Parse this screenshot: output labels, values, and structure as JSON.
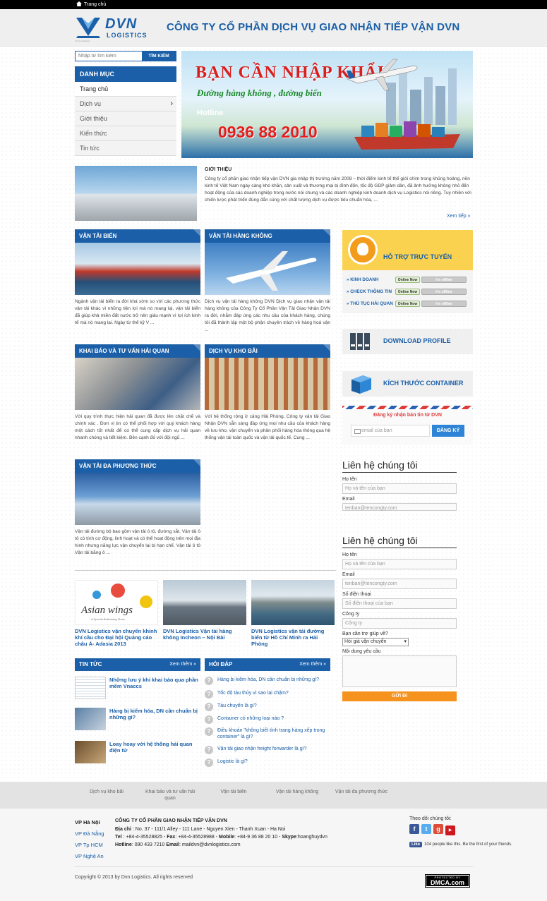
{
  "topbar": {
    "home": "Trang chủ"
  },
  "header": {
    "logo_main": "DVN",
    "logo_sub": "LOGISTICS",
    "logo_tag": "On time delivery",
    "title": "CÔNG TY CỔ PHẦN DỊCH VỤ GIAO NHẬN TIẾP VẬN DVN"
  },
  "search": {
    "placeholder": "Nhập từ tìm kiếm",
    "button": "TÌM KIẾM"
  },
  "menu": {
    "heading": "DANH MỤC",
    "items": [
      "Trang chủ",
      "Dịch vụ",
      "Giới thiệu",
      "Kiến thức",
      "Tin tức"
    ]
  },
  "banner": {
    "line1": "BẠN CẦN NHẬP KHẨU",
    "line2": "Đường hàng không , đường biển",
    "hotline_label": "Hotline",
    "hotline": "0936 88 2010"
  },
  "intro": {
    "title": "GIỚI THIỆU",
    "text": "Công ty cổ phần giao nhận tiếp vận DVN gia nhập thị trường năm 2008 – thời điểm kinh tế thế giới chìm trong khủng hoảng, nền kinh tế Việt Nam ngày càng khó khăn, sản xuất và thương mại bị đình đốn, tốc độ GDP giảm dần, đã ảnh hưởng không nhỏ đến hoạt động của các doanh nghiệp trong nước nói chung và các doanh nghiệp kinh doanh dịch vụ Logistics nói riêng. Tuy nhiên với chiến lược phát triển đúng đắn cùng với chất lượng dịch vụ được tiêu chuẩn hóa, ...",
    "more": "Xem tiếp »"
  },
  "services": [
    {
      "title": "VẬN TẢI BIỂN",
      "text": "Ngành vận tải biển ra đời khá sớm so với các phương thức vận tải khác vì những tiện lợi mà nó mang lại, vận tải biển đã giúp khả miền đất nước trở nên giàu mạnh vì lợi ích kinh tế mà nó mang lại. Ngày từ thế kỷ V ..."
    },
    {
      "title": "VẬN TẢI HÀNG KHÔNG",
      "text": "Dịch vụ vận tải hàng không DVN Dịch vụ giao nhận vận tải hàng không của Công Ty Cổ Phần Vận Tải Giao Nhận DVN ra đời, nhằm đáp ứng các nhu cầu của khách hàng, chúng tôi đã thành lập một bộ phận chuyên trách về hàng hoá vận ..."
    },
    {
      "title": "KHAI BÁO VÀ TƯ VẤN HẢI QUAN",
      "text": "Với quy trình thực hiện hải quan đã được lên chặt chẽ và chính xác . Đơn vị tin có thể phối hợp với quý khách hàng một cách tốt nhất để có thể cung cấp dịch vụ hải quan nhanh chóng và tiết kiệm. Bên cạnh đó với đội ngũ ..."
    },
    {
      "title": "DỊCH VỤ KHO BÃI",
      "text": "Với hệ thống rộng ở cảng Hải Phòng, Công ty vận tải Giao Nhận DVN sẵn sàng đáp ứng mọi nhu cầu của khách hàng về lưu kho, vận chuyển và phân phối hàng hóa thông qua hệ thống vận tải toàn quốc và vận tải quốc tế. Cung ..."
    },
    {
      "title": "VẬN TẢI ĐA PHƯƠNG THỨC",
      "text": "Vận tải đường bộ bao gồm vận tải ô tô, đường sắt. Vận tải ô tô có tính cơ động, linh hoạt và có thể hoạt động trên mọi địa hình nhưng năng lực vận chuyển lại bị hạn chế. Vận tải ô tô Vận tải bằng ô ..."
    }
  ],
  "gallery": [
    {
      "caption": "DVN Logistics vận chuyển khinh khí cầu cho Đại hội Quảng cáo châu Á- Adasia 2013",
      "img_text": "Asian wings",
      "img_sub": "A Special Ballooning Show"
    },
    {
      "caption": "DVN Logistics Vận tải hàng không Incheon – Nội Bài"
    },
    {
      "caption": "DVN Logistics vận tải đường biển từ Hồ Chí Minh ra Hải Phòng"
    }
  ],
  "news": {
    "heading": "TIN TỨC",
    "more": "Xem thêm »",
    "items": [
      "Những lưu ý khi khai báo qua phần mềm Vnaccs",
      "Hàng bị kiểm hóa, DN cần chuẩn bị những gì?",
      "Loay hoay với hệ thống hải quan điện tử"
    ]
  },
  "faq": {
    "heading": "HỎI ĐÁP",
    "more": "Xem thêm »",
    "items": [
      "Hàng bị kiểm hóa, DN cần chuẩn bị những gì?",
      "Tốc độ tàu thủy vì sao lại chậm?",
      "Tàu chuyến là gì?",
      "Container có những loại nào ?",
      "Điều khoản \"không biết tình trang hàng xếp trong container\" là gì?",
      "Vận tải giao nhận freight forwarder là gì?",
      "Logistic là gì?"
    ]
  },
  "support": {
    "title": "HỖ TRỢ TRỰC TUYẾN",
    "rows": [
      {
        "name": "» KINH DOANH",
        "on": "Online Now",
        "off": "I'm offline"
      },
      {
        "name": "» CHECK THÔNG TIN",
        "on": "Online Now",
        "off": "I'm offline"
      },
      {
        "name": "» THỦ TỤC HẢI QUAN",
        "on": "Online Now",
        "off": "I'm offline"
      }
    ]
  },
  "widgets": {
    "download": "DOWNLOAD PROFILE",
    "container": "KÍCH THƯỚC CONTAINER"
  },
  "newsletter": {
    "title": "Đăng ký nhận bản tin từ DVN",
    "placeholder": "email của bạn",
    "button": "ĐĂNG KÝ"
  },
  "contact1": {
    "heading": "Liên hệ chúng tôi",
    "name_label": "Họ tên",
    "name_ph": "Họ và tên của bạn",
    "email_label": "Email",
    "email_ph": "tenban@tencongty.com"
  },
  "contact2": {
    "heading": "Liên hệ chúng tôi",
    "name_label": "Họ tên",
    "name_ph": "Họ và tên của bạn",
    "email_label": "Email",
    "email_ph": "tenban@tencongty.com",
    "phone_label": "Số điện thoại",
    "phone_ph": "Số điện thoại của bạn",
    "company_label": "Công ty",
    "company_ph": "Công ty",
    "help_label": "Bạn cần trợ giúp về?",
    "help_value": "Hỏi giá vận chuyển",
    "msg_label": "Nội dung yêu cầu",
    "send": "GỬI ĐI"
  },
  "footnav": [
    "Dịch vụ kho bãi",
    "Khai báo và tư vấn hải quan",
    "Vận tải biển",
    "Vận tải hàng không",
    "Vận tải đa phương thức"
  ],
  "footer": {
    "offices_heading": "VP Hà Nội",
    "offices": [
      "VP Đà Nẵng",
      "VP Tp HCM",
      "VP Nghệ An"
    ],
    "company": "CÔNG TY CỔ PHẦN GIAO NHẬN TIẾP VẬN DVN",
    "addr_label": "Địa chỉ",
    "addr": " : No. 37 - 111/1 Alley - 111 Lane - Nguyen Xien - Thanh Xuan - Ha Noi",
    "tel_label": "Tel",
    "tel": " : +84-4-35528825 - ",
    "fax_label": "Fax",
    "fax": ": +84-4-35528988 - ",
    "mobile_label": "Mobile",
    "mobile": ": +84-9 36 88 20 10 - ",
    "skype_label": "Skype",
    "skype": ":hoanghuydvn",
    "hotline_label": "Hotline",
    "hotline": ": 090 433 7210 ",
    "email_label": "Email",
    "email": ": maildvn@dvnlogistics.com",
    "follow": "Theo dõi chúng tôi:",
    "like_btn": "Like",
    "like_text": "104 people like this. Be the first of your friends.",
    "copyright": "Copyright © 2013 by Dvn Logistics. All rights reserved",
    "dmca_top": "PROTECTED BY",
    "dmca": "DMCA.com"
  }
}
